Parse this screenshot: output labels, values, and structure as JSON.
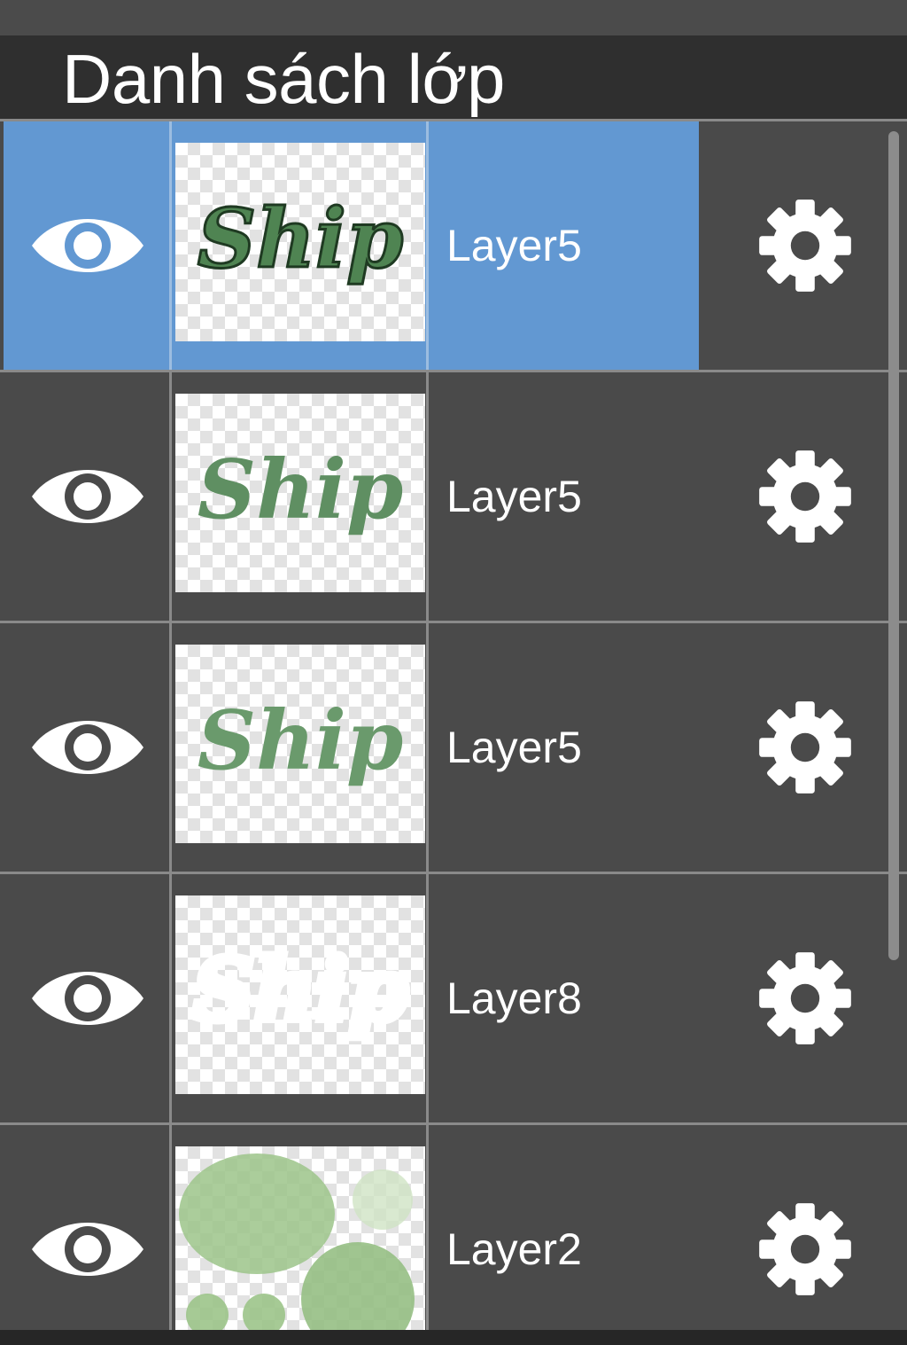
{
  "panel": {
    "title": "Danh sách lớp"
  },
  "layers": [
    {
      "name": "Layer5",
      "selected": true,
      "visible": true,
      "thumb_text": "Ship"
    },
    {
      "name": "Layer5",
      "selected": false,
      "visible": true,
      "thumb_text": "Ship"
    },
    {
      "name": "Layer5",
      "selected": false,
      "visible": true,
      "thumb_text": "Ship"
    },
    {
      "name": "Layer8",
      "selected": false,
      "visible": true,
      "thumb_text": "Ship"
    },
    {
      "name": "Layer2",
      "selected": false,
      "visible": true,
      "thumb_text": ""
    }
  ],
  "icons": {
    "visibility": "eye-icon",
    "settings": "gear-icon"
  },
  "colors": {
    "selected_row": "#6298d2",
    "row_background": "#4a4a4a",
    "header_background": "#2f2f2f",
    "ship_green": "#5f8f62",
    "blob_green": "#9cc48a"
  }
}
